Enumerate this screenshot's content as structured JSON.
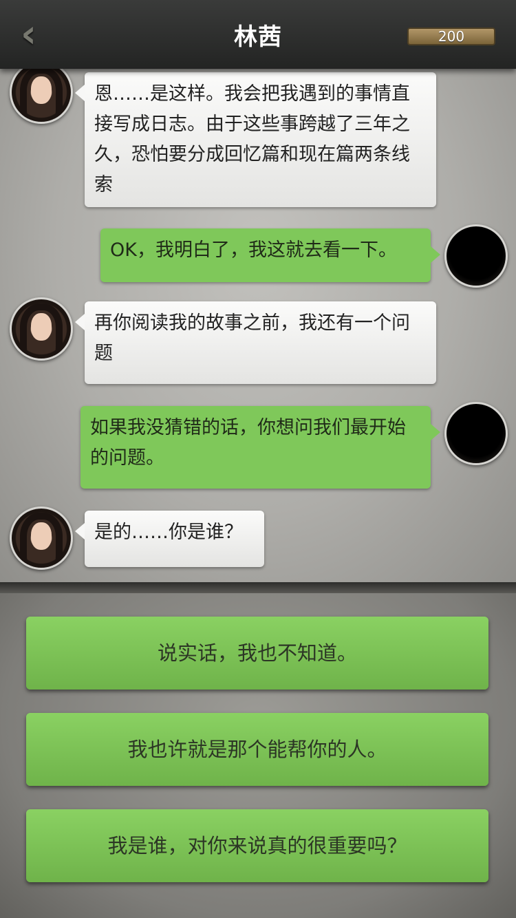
{
  "header": {
    "back_glyph": "‹",
    "title": "林茜",
    "coins": "200"
  },
  "messages": [
    {
      "sender": "her",
      "text": "恩……是这样。我会把我遇到的事情直接写成日志。由于这些事跨越了三年之久，恐怕要分成回忆篇和现在篇两条线索"
    },
    {
      "sender": "me",
      "text": "OK，我明白了，我这就去看一下。"
    },
    {
      "sender": "her",
      "text": "再你阅读我的故事之前，我还有一个问题"
    },
    {
      "sender": "me",
      "text": "如果我没猜错的话，你想问我们最开始的问题。"
    },
    {
      "sender": "her",
      "text": "是的……你是谁？"
    }
  ],
  "choices": [
    {
      "label": "说实话，我也不知道。"
    },
    {
      "label": "我也许就是那个能帮你的人。"
    },
    {
      "label": "我是谁，对你来说真的很重要吗？"
    }
  ],
  "colors": {
    "my_bubble": "#7fc85a",
    "her_bubble": "#f7f7f6",
    "choice_button": "#7dc356",
    "coin_bar": "#9a8150"
  }
}
